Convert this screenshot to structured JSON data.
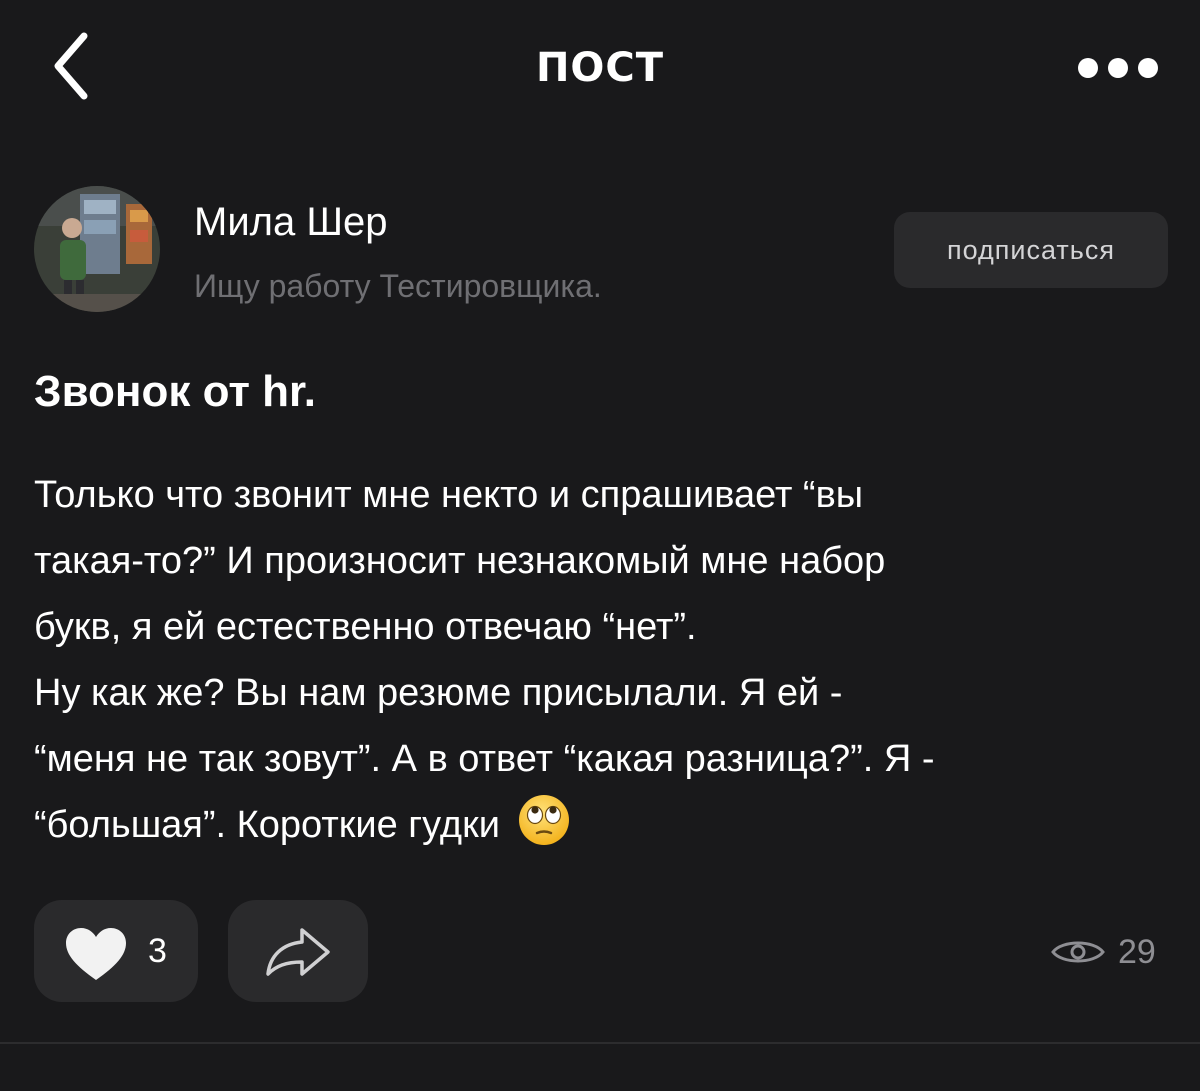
{
  "header": {
    "title": "ПОСТ",
    "back_icon": "chevron-left-icon",
    "more_icon": "more-dots-icon"
  },
  "author": {
    "name": "Мила Шер",
    "status": "Ищу работу Тестировщика.",
    "subscribe_label": "подписаться"
  },
  "post": {
    "title": "Звонок от hr.",
    "body_lines": [
      "Только что звонит мне некто и спрашивает “вы",
      "такая-то?” И произносит незнакомый мне набор",
      "букв, я ей естественно отвечаю “нет”.",
      "Ну как же? Вы нам резюме присылали. Я ей -",
      "“меня не так зовут”. А в ответ “какая разница?”. Я -",
      "“большая”. Короткие гудки"
    ],
    "emoji_icon": "eye-roll-emoji-icon"
  },
  "actions": {
    "likes": "3",
    "views": "29",
    "like_icon": "heart-icon",
    "share_icon": "share-arrow-icon",
    "views_icon": "eye-icon"
  },
  "colors": {
    "background": "#19191b",
    "button_bg": "#2a2a2c",
    "secondary_text": "#6f6f73",
    "views_text": "#8e8e93"
  }
}
